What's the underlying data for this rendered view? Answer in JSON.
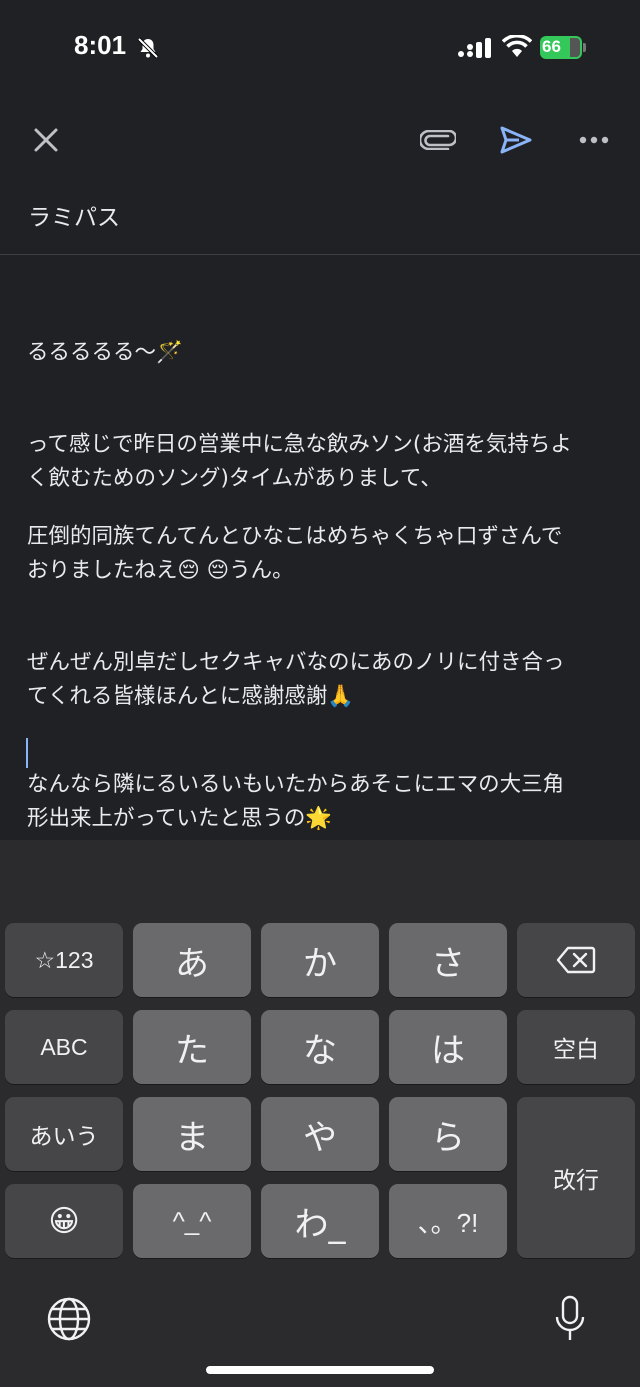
{
  "status": {
    "time": "8:01",
    "battery": "66"
  },
  "toolbar": {
    "close_icon": "close-icon",
    "attach_icon": "paperclip-icon",
    "send_icon": "send-icon",
    "more_icon": "more-horizontal-icon",
    "accent": "#8ab4f8"
  },
  "subject": "ラミパス",
  "body": {
    "line1": "るるるるる〜🪄",
    "para1a": "って感じで昨日の営業中に急な飲みソン(お酒を気持ちよ",
    "para1b": "く飲むためのソング)タイムがありまして、",
    "para2a": "圧倒的同族てんてんとひなこはめちゃくちゃ口ずさんで",
    "para2b": "おりましたねえ😔 😔うん。",
    "para3a": "ぜんぜん別卓だしセクキャバなのにあのノリに付き合っ",
    "para3b": "てくれる皆様ほんとに感謝感謝🙏",
    "para4a": "なんなら隣にるいるいもいたからあそこにエマの大三角",
    "para4b": "形出来上がっていたと思うの🌟"
  },
  "keyboard": {
    "symbols": "☆123",
    "a": "あ",
    "ka": "か",
    "sa": "さ",
    "backspace_icon": "backspace-icon",
    "abc": "ABC",
    "ta": "た",
    "na": "な",
    "ha": "は",
    "space": "空白",
    "aiu": "あいう",
    "ma": "ま",
    "ya": "や",
    "ra": "ら",
    "enter": "改行",
    "emoji": "😀",
    "kaomoji": "^_^",
    "wa": "わ_",
    "punct": "、。?!",
    "globe_icon": "globe-icon",
    "mic_icon": "microphone-icon"
  }
}
